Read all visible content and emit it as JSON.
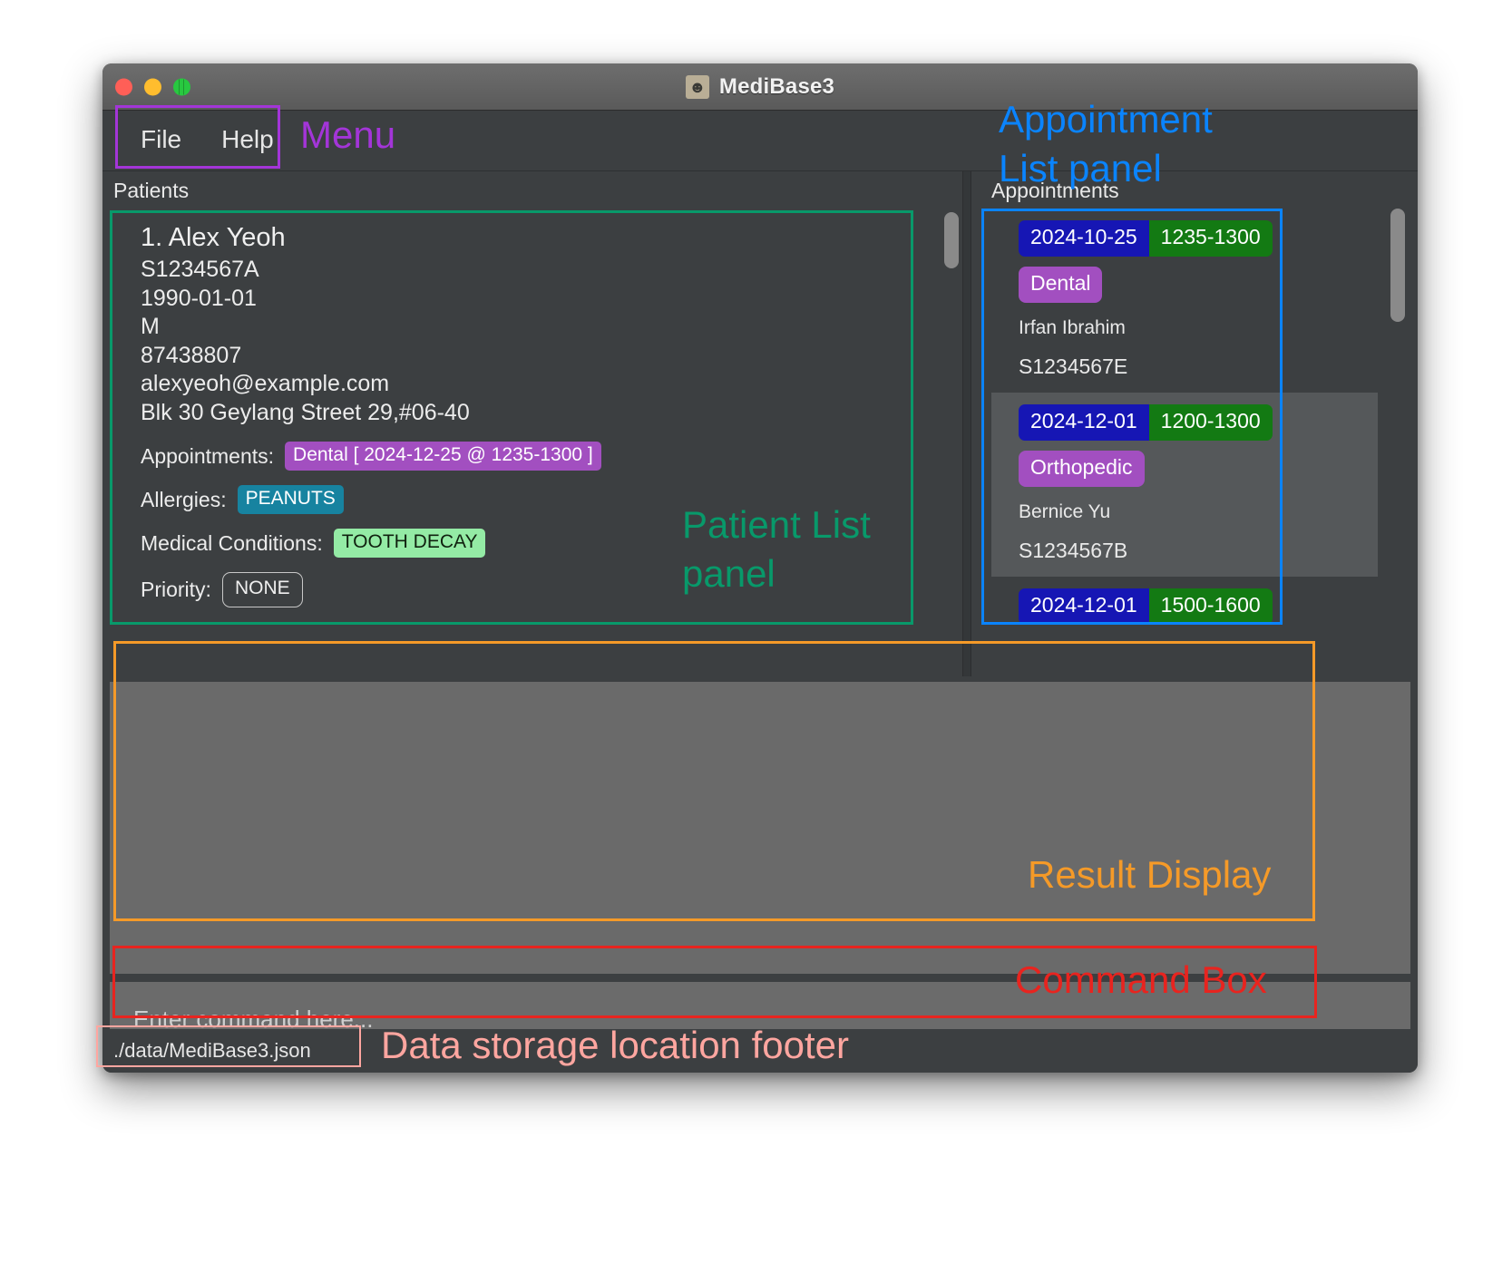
{
  "window": {
    "title": "MediBase3",
    "app_icon": "contact-card-icon",
    "controls": [
      "close-button",
      "minimize-button",
      "zoom-button"
    ]
  },
  "menu": {
    "items": [
      {
        "label": "File"
      },
      {
        "label": "Help"
      }
    ]
  },
  "patients_panel": {
    "label": "Patients",
    "patient": {
      "name": "1. Alex Yeoh",
      "nric": "S1234567A",
      "dob": "1990-01-01",
      "gender": "M",
      "phone": "87438807",
      "email": "alexyeoh@example.com",
      "address": "Blk 30 Geylang Street 29,#06-40",
      "appointments_label": "Appointments:",
      "appointments_chip": "Dental [ 2024-12-25 @ 1235-1300 ]",
      "allergies_label": "Allergies:",
      "allergies_chip": "PEANUTS",
      "conditions_label": "Medical Conditions:",
      "conditions_chip": "TOOTH DECAY",
      "priority_label": "Priority:",
      "priority_chip": "NONE"
    }
  },
  "appointments_panel": {
    "label": "Appointments",
    "items": [
      {
        "date": "2024-10-25",
        "time": "1235-1300",
        "type": "Dental",
        "person": "Irfan Ibrahim",
        "nric": "S1234567E"
      },
      {
        "date": "2024-12-01",
        "time": "1200-1300",
        "type": "Orthopedic",
        "person": "Bernice Yu",
        "nric": "S1234567B"
      },
      {
        "date": "2024-12-01",
        "time": "1500-1600",
        "type": "",
        "person": "",
        "nric": ""
      }
    ]
  },
  "result_display": {
    "text": ""
  },
  "command_box": {
    "placeholder": "Enter command here...",
    "value": ""
  },
  "footer": {
    "path": "./data/MediBase3.json"
  },
  "annotations": [
    {
      "label": "Menu",
      "color": "#a335d8"
    },
    {
      "label": "Appointment",
      "color": "#0a84ff"
    },
    {
      "label": "List panel",
      "color": "#0a84ff"
    },
    {
      "label": "Patient List",
      "color": "#08996a"
    },
    {
      "label": "panel",
      "color": "#08996a"
    },
    {
      "label": "Result Display",
      "color": "#f59a28"
    },
    {
      "label": "Command Box",
      "color": "#e8241f"
    },
    {
      "label": "Data storage location footer",
      "color": "#ffa6a0"
    }
  ],
  "colors": {
    "menu_outline": "#a335d8",
    "appointment_outline": "#0a84ff",
    "patient_outline": "#08996a",
    "result_outline": "#f59a28",
    "command_outline": "#e8241f",
    "footer_outline": "#ffa6a0",
    "date_tag": "#1616b4",
    "time_tag": "#137a13",
    "type_tag": "#a24fc0",
    "allergy_tag": "#1783a0",
    "condition_tag": "#94eba5"
  }
}
